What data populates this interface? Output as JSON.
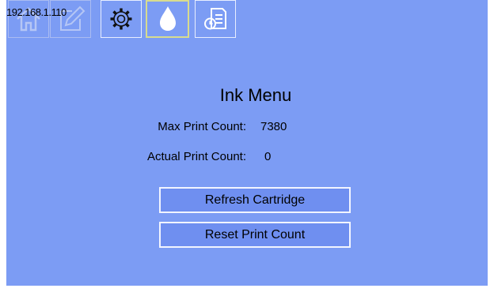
{
  "device": {
    "ip_address": "192.168.1.110"
  },
  "toolbar": {
    "items": [
      {
        "name": "home",
        "icon": "home-icon",
        "state": "disabled"
      },
      {
        "name": "edit",
        "icon": "edit-pencil-icon",
        "state": "disabled"
      },
      {
        "name": "settings",
        "icon": "gear-icon",
        "state": "normal"
      },
      {
        "name": "ink",
        "icon": "ink-drop-icon",
        "state": "selected"
      },
      {
        "name": "report",
        "icon": "document-report-icon",
        "state": "normal"
      }
    ]
  },
  "ink_menu": {
    "title": "Ink Menu",
    "max_print_count_label": "Max Print Count:",
    "max_print_count_value": "7380",
    "actual_print_count_label": "Actual Print Count:",
    "actual_print_count_value": "0"
  },
  "buttons": {
    "refresh_cartridge": "Refresh Cartridge",
    "reset_print_count": "Reset Print Count"
  },
  "colors": {
    "background": "#7c9cf4",
    "button_fill": "#6f8ff0",
    "button_border": "#f2f5ff",
    "selected_border": "#d8dc8e"
  }
}
